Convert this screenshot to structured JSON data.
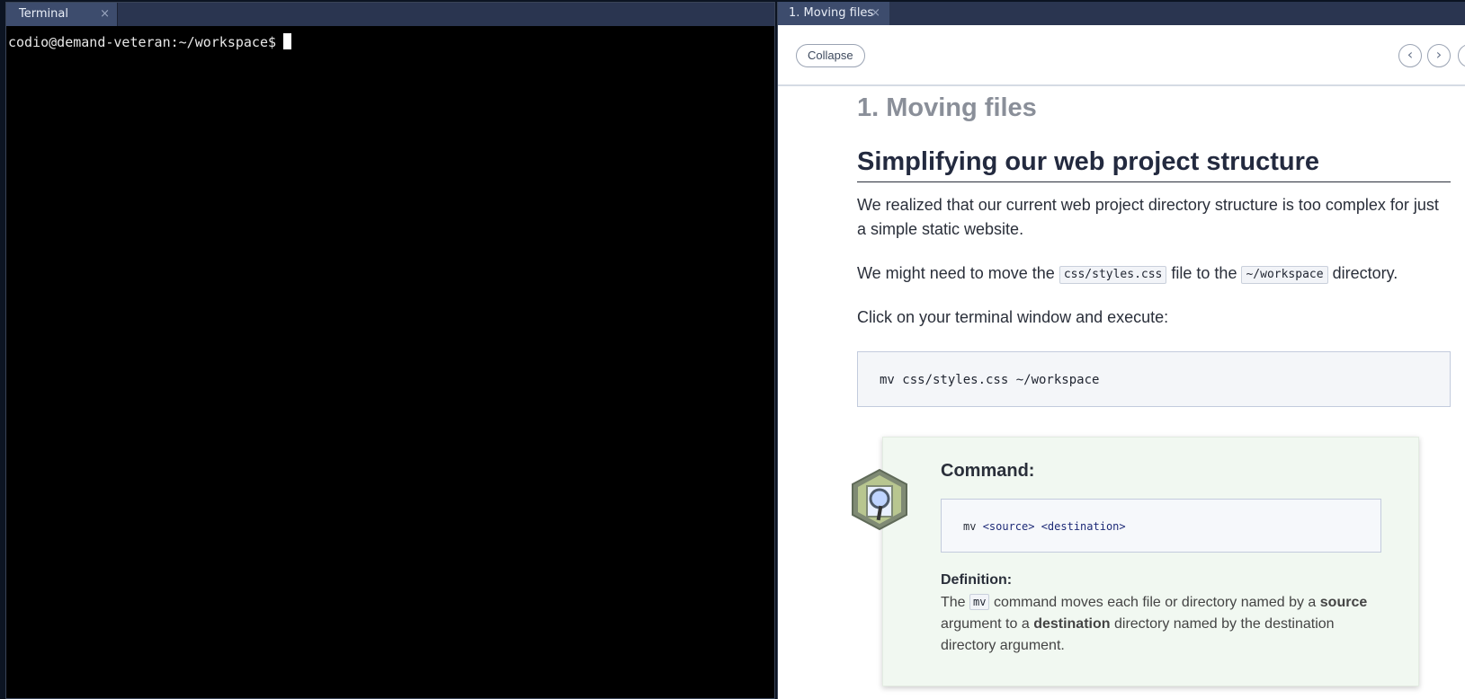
{
  "terminal": {
    "tab_label": "Terminal",
    "tab_close": "×",
    "prompt": "codio@demand-veteran:~/workspace$"
  },
  "guide": {
    "tab_label": "1. Moving files",
    "tab_close": "×",
    "collapse_label": "Collapse",
    "nav_prev": "‹",
    "nav_next": "›",
    "page_title": "1. Moving files",
    "section_title": "Simplifying our web project structure",
    "para1": "We realized that our current web project directory structure is too complex for just a simple static website.",
    "para2_before": "We might need to move the",
    "para2_code1": "css/styles.css",
    "para2_middle": "file to the",
    "para2_code2": "~/workspace",
    "para2_after": "directory.",
    "para3": "Click on your terminal window and execute:",
    "code": "mv css/styles.css ~/workspace",
    "command_card": {
      "title": "Command:",
      "code_cmd": "mv",
      "code_args": "<source> <destination>",
      "def_title": "Definition:",
      "def_prefix": "The",
      "def_code": "mv",
      "def_part1": "command moves each file or directory named by a",
      "def_bold1": "source",
      "def_part2": "argument to a",
      "def_bold2": "destination",
      "def_part3": "directory named by the destination directory argument."
    }
  },
  "icons": {
    "magnifier": "magnifier-icon"
  }
}
